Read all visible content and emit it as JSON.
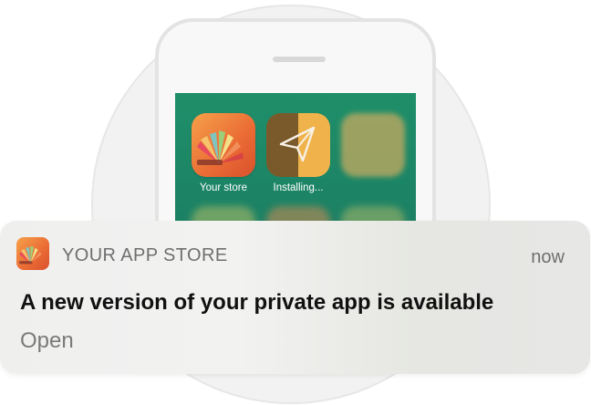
{
  "home_screen": {
    "apps": [
      {
        "name": "Your store",
        "icon": "feather-fan-icon"
      },
      {
        "name": "Installing...",
        "icon": "paper-plane-icon"
      }
    ]
  },
  "notification": {
    "app_name": "YOUR APP STORE",
    "time": "now",
    "title": "A new version of your private app is available",
    "action": "Open",
    "icon": "feather-fan-icon"
  },
  "colors": {
    "screen": "#1b7f63",
    "app_orange": "#ea6a34",
    "text_primary": "#111111",
    "text_secondary": "#6f6f6f"
  }
}
